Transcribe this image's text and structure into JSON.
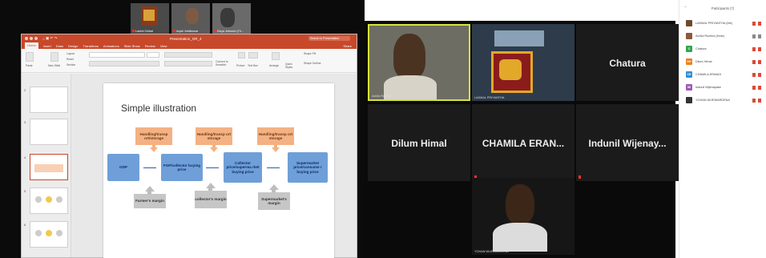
{
  "thumbnails": [
    {
      "caption": "Lankhi Chitral"
    },
    {
      "caption": "Anjali Jothikumar"
    },
    {
      "caption": "Divya Jebeesh (Tri..."
    }
  ],
  "ppt": {
    "title": "Presentation_GR_4",
    "search_placeholder": "Search in Presentation",
    "tabs": [
      "Home",
      "Insert",
      "Draw",
      "Design",
      "Transitions",
      "Animations",
      "Slide Show",
      "Review",
      "View"
    ],
    "share_label": "Share",
    "ribbon": {
      "paste": "Paste",
      "new_slide": "New Slide",
      "layout": "Layout",
      "reset": "Reset",
      "section": "Section",
      "convert": "Convert to SmartArt",
      "picture": "Picture",
      "textbox": "Text Box",
      "arrange": "Arrange",
      "quick_styles": "Quick Styles",
      "shape_fill": "Shape Fill",
      "shape_outline": "Shape Outline"
    },
    "slide_numbers": [
      "2",
      "3",
      "4",
      "5",
      "6"
    ],
    "slide": {
      "title": "Simple illustration",
      "top_boxes": [
        "Handling/transp ort/storage",
        "Handling/transp ort storage",
        "Handling/transp ort storage"
      ],
      "chain": [
        "GDP",
        "FGP/collector buying price",
        "Collector price/superma rket buying price",
        "Supermarket price/consume r buying price"
      ],
      "margins": [
        "Farmer's margin",
        "collector's margin",
        "Supermarket's margin"
      ]
    }
  },
  "gallery": {
    "tiles": [
      {
        "caption": "Achila Ruchira"
      },
      {
        "caption": "LAKMAL PRIYANTHA"
      },
      {
        "name": "Chatura"
      },
      {
        "name": "Dilum Himal"
      },
      {
        "name": "CHAMILA ERAN..."
      },
      {
        "name": "Indunil Wijenay..."
      },
      {
        "caption": "YOHAN WIJEWARDENA"
      }
    ]
  },
  "participants": {
    "header": "Participants (7)",
    "list": [
      {
        "name": "LAKMAL PRIYANTHA (Me)",
        "avatar": "",
        "color": "#6b4a2e"
      },
      {
        "name": "Achila Ruchira (Host)",
        "avatar": "",
        "color": "#8a5a3c"
      },
      {
        "name": "Chatura",
        "avatar": "C",
        "color": "#2fa84f"
      },
      {
        "name": "Dilum Himal",
        "avatar": "DH",
        "color": "#ef7d1a"
      },
      {
        "name": "CHAMILA ERANDI",
        "avatar": "CE",
        "color": "#2d8fd8"
      },
      {
        "name": "Indunil Wijenayake",
        "avatar": "IW",
        "color": "#9b59b6"
      },
      {
        "name": "YOHAN WIJEWARDENA",
        "avatar": "",
        "color": "#333333"
      }
    ]
  }
}
